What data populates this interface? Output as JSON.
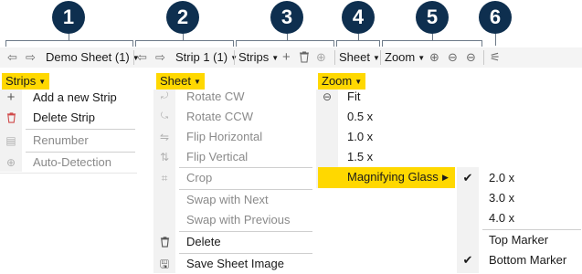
{
  "callouts": [
    "1",
    "2",
    "3",
    "4",
    "5",
    "6"
  ],
  "toolbar": {
    "doc_label": "Demo Sheet (1)",
    "strip_label": "Strip 1 (1)",
    "strips_label": "Strips",
    "sheet_label": "Sheet",
    "zoom_label": "Zoom"
  },
  "strips_menu": {
    "header": "Strips",
    "items": [
      {
        "label": "Add a new Strip",
        "icon": "plus-icon",
        "enabled": true
      },
      {
        "label": "Delete Strip",
        "icon": "trash-icon",
        "enabled": true
      },
      {
        "label": "Renumber",
        "icon": "renumber-icon",
        "enabled": false
      },
      {
        "label": "Auto-Detection",
        "icon": "auto-detect-icon",
        "enabled": false
      }
    ]
  },
  "sheet_menu": {
    "header": "Sheet",
    "items": [
      {
        "label": "Rotate CW",
        "icon": "rotate-cw-icon",
        "enabled": false
      },
      {
        "label": "Rotate CCW",
        "icon": "rotate-ccw-icon",
        "enabled": false
      },
      {
        "label": "Flip Horizontal",
        "icon": "flip-horizontal-icon",
        "enabled": false
      },
      {
        "label": "Flip Vertical",
        "icon": "flip-vertical-icon",
        "enabled": false
      },
      {
        "label": "Crop",
        "icon": "crop-icon",
        "enabled": false
      },
      {
        "label": "Swap with Next",
        "icon": "",
        "enabled": false
      },
      {
        "label": "Swap with Previous",
        "icon": "",
        "enabled": false
      },
      {
        "label": "Delete",
        "icon": "trash-icon",
        "enabled": true
      },
      {
        "label": "Save Sheet Image",
        "icon": "save-image-icon",
        "enabled": true
      }
    ]
  },
  "zoom_menu": {
    "header": "Zoom",
    "items": [
      {
        "label": "Fit",
        "icon": "zoom-fit-icon"
      },
      {
        "label": "0.5 x"
      },
      {
        "label": "1.0 x"
      },
      {
        "label": "1.5 x"
      },
      {
        "label": "Magnifying Glass",
        "submenu": true,
        "highlighted": true
      }
    ]
  },
  "magnifier_menu": {
    "items": [
      {
        "label": "2.0 x",
        "checked": true
      },
      {
        "label": "3.0 x",
        "checked": false
      },
      {
        "label": "4.0 x",
        "checked": false
      },
      {
        "label": "Top Marker",
        "checked": false
      },
      {
        "label": "Bottom Marker",
        "checked": true
      }
    ]
  },
  "colors": {
    "highlight": "#ffd800",
    "badge": "#0e2f4f",
    "toolbar_bg": "#f4f4f4"
  }
}
